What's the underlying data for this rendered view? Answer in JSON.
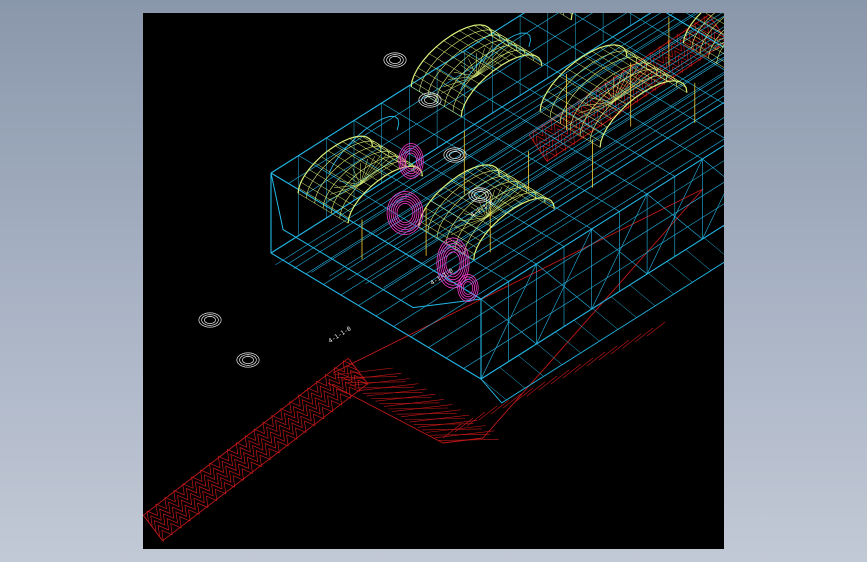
{
  "colors": {
    "background_gradient_top": "#8a97ab",
    "background_gradient_bottom": "#c2c9d6",
    "viewport": "#000000",
    "ground_lines": "#c01818",
    "frame_lines": "#23b7e6",
    "shroud_lines": "#d8f07a",
    "internal_lines": "#f03cc8",
    "detail_lines": "#f0f0f0",
    "accent_lines": "#f5d23a"
  },
  "drawing": {
    "view": "isometric-wireframe",
    "labels": [
      "4-1-1-0",
      "4-1-1-0",
      "4-1-1-0"
    ]
  }
}
